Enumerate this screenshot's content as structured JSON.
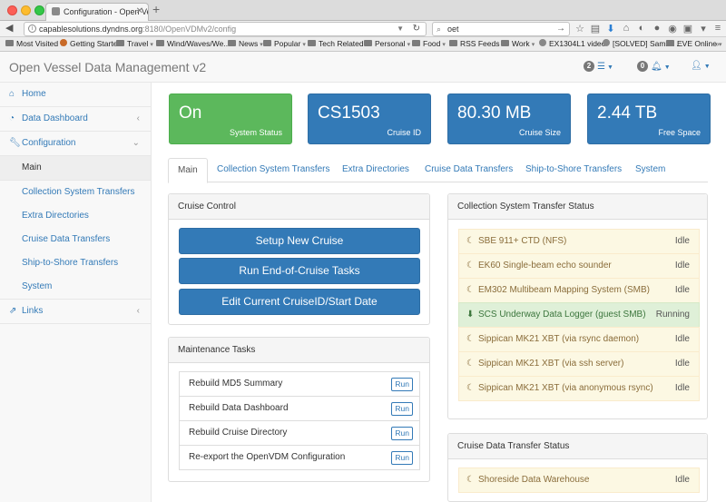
{
  "browser": {
    "tab_title": "Configuration - Open Vessel Dat...",
    "url_host": "capablesolutions.dyndns.org",
    "url_path": ":8180/OpenVDMv2/config",
    "search_text": "oet",
    "bookmarks": [
      {
        "label": "Most Visited",
        "type": "folder"
      },
      {
        "label": "Getting Started",
        "type": "site"
      },
      {
        "label": "Travel",
        "type": "folder"
      },
      {
        "label": "Wind/Waves/We...",
        "type": "folder"
      },
      {
        "label": "News",
        "type": "folder"
      },
      {
        "label": "Popular",
        "type": "folder"
      },
      {
        "label": "Tech Related",
        "type": "folder"
      },
      {
        "label": "Personal",
        "type": "folder"
      },
      {
        "label": "Food",
        "type": "folder"
      },
      {
        "label": "RSS Feeds",
        "type": "folder"
      },
      {
        "label": "Work",
        "type": "folder"
      },
      {
        "label": "EX1304L1 video",
        "type": "site"
      },
      {
        "label": "[SOLVED] Samba ...",
        "type": "site"
      },
      {
        "label": "EVE Online",
        "type": "folder"
      }
    ]
  },
  "header": {
    "brand": "Open Vessel Data Management v2",
    "tasks_count": "2",
    "notifications_count": "0"
  },
  "sidebar": {
    "items": [
      {
        "label": "Home",
        "icon": "home-icon"
      },
      {
        "label": "Data Dashboard",
        "icon": "dashboard-icon"
      },
      {
        "label": "Configuration",
        "icon": "wrench-icon"
      },
      {
        "label": "Main"
      },
      {
        "label": "Collection System Transfers"
      },
      {
        "label": "Extra Directories"
      },
      {
        "label": "Cruise Data Transfers"
      },
      {
        "label": "Ship-to-Shore Transfers"
      },
      {
        "label": "System"
      },
      {
        "label": "Links",
        "icon": "external-link-icon"
      }
    ]
  },
  "tiles": [
    {
      "value": "On",
      "label": "System Status",
      "color": "#5cb85c"
    },
    {
      "value": "CS1503",
      "label": "Cruise ID",
      "color": "#337ab7"
    },
    {
      "value": "80.30 MB",
      "label": "Cruise Size",
      "color": "#337ab7"
    },
    {
      "value": "2.44 TB",
      "label": "Free Space",
      "color": "#337ab7"
    }
  ],
  "tabs": [
    "Main",
    "Collection System Transfers",
    "Extra Directories",
    "Cruise Data Transfers",
    "Ship-to-Shore Transfers",
    "System"
  ],
  "cruise_control": {
    "title": "Cruise Control",
    "buttons": [
      "Setup New Cruise",
      "Run End-of-Cruise Tasks",
      "Edit Current CruiseID/Start Date"
    ]
  },
  "maintenance": {
    "title": "Maintenance Tasks",
    "run_label": "Run",
    "tasks": [
      "Rebuild MD5 Summary",
      "Rebuild Data Dashboard",
      "Rebuild Cruise Directory",
      "Re-export the OpenVDM Configuration"
    ]
  },
  "collection_status": {
    "title": "Collection System Transfer Status",
    "rows": [
      {
        "name": "SBE 911+ CTD (NFS)",
        "status": "Idle",
        "state": "idle"
      },
      {
        "name": "EK60 Single-beam echo sounder",
        "status": "Idle",
        "state": "idle"
      },
      {
        "name": "EM302 Multibeam Mapping System (SMB)",
        "status": "Idle",
        "state": "idle"
      },
      {
        "name": "SCS Underway Data Logger (guest SMB)",
        "status": "Running",
        "state": "running"
      },
      {
        "name": "Sippican MK21 XBT (via rsync daemon)",
        "status": "Idle",
        "state": "idle"
      },
      {
        "name": "Sippican MK21 XBT (via ssh server)",
        "status": "Idle",
        "state": "idle"
      },
      {
        "name": "Sippican MK21 XBT (via anonymous rsync)",
        "status": "Idle",
        "state": "idle"
      }
    ]
  },
  "cruise_data_status": {
    "title": "Cruise Data Transfer Status",
    "rows": [
      {
        "name": "Shoreside Data Warehouse",
        "status": "Idle",
        "state": "idle"
      }
    ]
  }
}
